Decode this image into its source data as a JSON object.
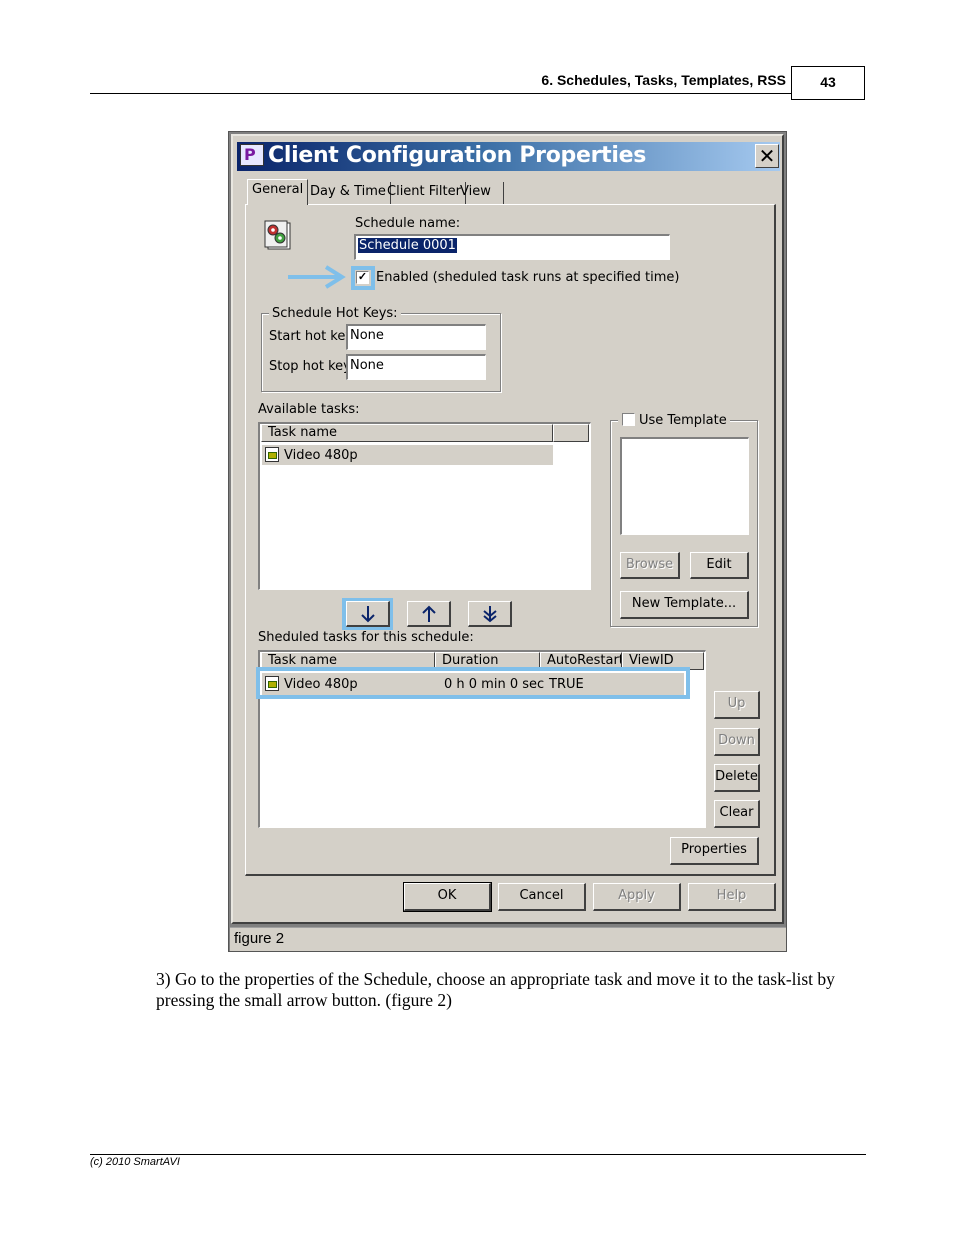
{
  "header": {
    "section_title": "6. Schedules, Tasks, Templates, RSS",
    "page_number": "43"
  },
  "dialog": {
    "title": "Client Configuration Properties",
    "close_glyph": "✕",
    "tabs": [
      {
        "label": "General",
        "active": true
      },
      {
        "label": "Day & Time",
        "active": false
      },
      {
        "label": "Client Filter",
        "active": false
      },
      {
        "label": "View",
        "active": false
      }
    ],
    "schedule_name_label": "Schedule name:",
    "schedule_name_value": "Schedule 0001",
    "enabled_checkbox": {
      "label": "Enabled (sheduled task runs at specified time)",
      "checked": true
    },
    "hotkeys": {
      "group_label": "Schedule Hot Keys:",
      "start_label": "Start hot key:",
      "start_value": "None",
      "stop_label": "Stop hot key:",
      "stop_value": "None"
    },
    "available_tasks": {
      "label": "Available tasks:",
      "column": "Task name",
      "rows": [
        "Video 480p"
      ]
    },
    "template": {
      "use_template_label": "Use Template",
      "checked": false,
      "browse_label": "Browse",
      "edit_label": "Edit",
      "new_template_label": "New Template..."
    },
    "arrow_buttons": {
      "move_down": "↓",
      "move_up": "↑",
      "move_all_down": "↡"
    },
    "scheduled_tasks": {
      "label": "Sheduled tasks for this schedule:",
      "columns": [
        "Task name",
        "Duration",
        "AutoRestart",
        "ViewID"
      ],
      "rows": [
        {
          "task_name": "Video 480p",
          "duration": "0 h 0 min 0 sec",
          "autorestart": "TRUE",
          "viewid": ""
        }
      ]
    },
    "side_buttons": {
      "up": "Up",
      "down": "Down",
      "delete": "Delete",
      "clear": "Clear"
    },
    "properties_label": "Properties",
    "footer_buttons": {
      "ok": "OK",
      "cancel": "Cancel",
      "apply": "Apply",
      "help": "Help"
    }
  },
  "figure_caption": "figure 2",
  "body_text": "3) Go to the properties of the Schedule, choose an appropriate task and move it to the task-list by pressing the small arrow button. (figure 2)",
  "footer": {
    "copyright": "(c) 2010 SmartAVI"
  },
  "colors": {
    "highlight_blue": "#7fbfea",
    "title_gradient_start": "#0a246a",
    "title_gradient_end": "#a6caf0",
    "dialog_face": "#d4d0c8"
  }
}
